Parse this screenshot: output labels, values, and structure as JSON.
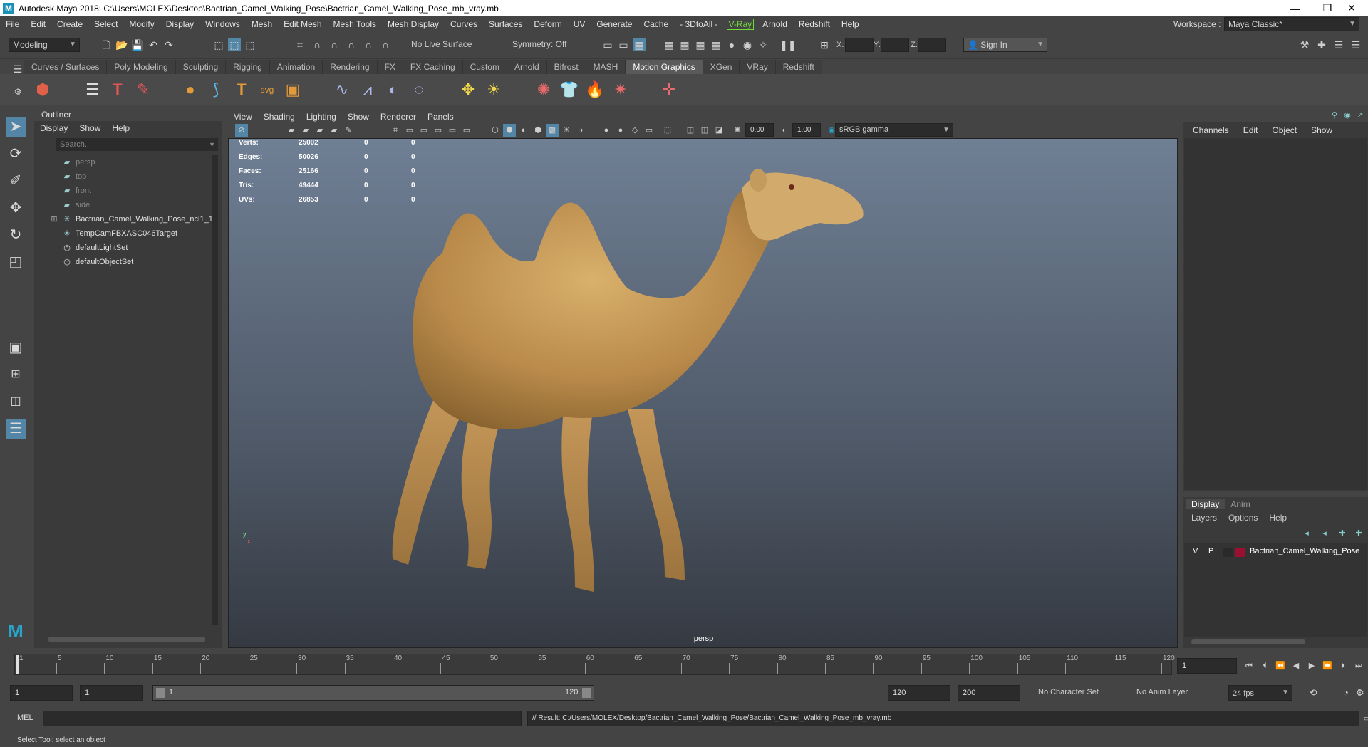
{
  "window": {
    "title": "Autodesk Maya 2018: C:\\Users\\MOLEX\\Desktop\\Bactrian_Camel_Walking_Pose\\Bactrian_Camel_Walking_Pose_mb_vray.mb",
    "logo": "M",
    "minimize": "—",
    "restore": "❐",
    "close": "✕"
  },
  "menubar": {
    "items": [
      "File",
      "Edit",
      "Create",
      "Select",
      "Modify",
      "Display",
      "Windows",
      "Mesh",
      "Edit Mesh",
      "Mesh Tools",
      "Mesh Display",
      "Curves",
      "Surfaces",
      "Deform",
      "UV",
      "Generate",
      "Cache",
      "- 3DtoAll -"
    ],
    "vray": "V-Ray",
    "items2": [
      "Arnold",
      "Redshift",
      "Help"
    ],
    "workspace_label": "Workspace :",
    "workspace_value": "Maya Classic*"
  },
  "statusline": {
    "mode": "Modeling",
    "live_surface": "No Live Surface",
    "symmetry": "Symmetry: Off",
    "x_label": "X:",
    "y_label": "Y:",
    "z_label": "Z:",
    "sign_in": "Sign In"
  },
  "shelf": {
    "tabs": [
      "Curves / Surfaces",
      "Poly Modeling",
      "Sculpting",
      "Rigging",
      "Animation",
      "Rendering",
      "FX",
      "FX Caching",
      "Custom",
      "Arnold",
      "Bifrost",
      "MASH",
      "Motion Graphics",
      "XGen",
      "VRay",
      "Redshift"
    ],
    "active_tab": "Motion Graphics"
  },
  "outliner": {
    "title": "Outliner",
    "menu": [
      "Display",
      "Show",
      "Help"
    ],
    "search_placeholder": "Search...",
    "items": [
      {
        "label": "persp",
        "dim": true
      },
      {
        "label": "top",
        "dim": true
      },
      {
        "label": "front",
        "dim": true
      },
      {
        "label": "side",
        "dim": true
      },
      {
        "label": "Bactrian_Camel_Walking_Pose_ncl1_1",
        "dim": false
      },
      {
        "label": "TempCamFBXASC046Target",
        "dim": false
      },
      {
        "label": "defaultLightSet",
        "dim": false
      },
      {
        "label": "defaultObjectSet",
        "dim": false
      }
    ]
  },
  "viewport": {
    "menu": [
      "View",
      "Shading",
      "Lighting",
      "Show",
      "Renderer",
      "Panels"
    ],
    "exposure": "0.00",
    "gamma": "1.00",
    "color_space": "sRGB gamma",
    "camera": "persp",
    "axis_y": "y",
    "axis_x": "x",
    "hud": [
      {
        "label": "Verts:",
        "v1": "25002",
        "v2": "0",
        "v3": "0"
      },
      {
        "label": "Edges:",
        "v1": "50026",
        "v2": "0",
        "v3": "0"
      },
      {
        "label": "Faces:",
        "v1": "25166",
        "v2": "0",
        "v3": "0"
      },
      {
        "label": "Tris:",
        "v1": "49444",
        "v2": "0",
        "v3": "0"
      },
      {
        "label": "UVs:",
        "v1": "26853",
        "v2": "0",
        "v3": "0"
      }
    ]
  },
  "channelbox": {
    "menu": [
      "Channels",
      "Edit",
      "Object",
      "Show"
    ]
  },
  "layers": {
    "tabs": [
      "Display",
      "Anim"
    ],
    "menu": [
      "Layers",
      "Options",
      "Help"
    ],
    "layer": {
      "v": "V",
      "p": "P",
      "name": "Bactrian_Camel_Walking_Pose",
      "color": "#9b1030"
    }
  },
  "timeline": {
    "ticks": [
      "1",
      "5",
      "10",
      "15",
      "20",
      "25",
      "30",
      "35",
      "40",
      "45",
      "50",
      "55",
      "60",
      "65",
      "70",
      "75",
      "80",
      "85",
      "90",
      "95",
      "100",
      "105",
      "110",
      "115",
      "120"
    ],
    "current_frame": "1"
  },
  "range": {
    "start": "1",
    "playback_start": "1",
    "slider_start": "1",
    "slider_end": "120",
    "playback_end": "120",
    "end": "200",
    "character_set": "No Character Set",
    "anim_layer": "No Anim Layer",
    "fps": "24 fps"
  },
  "commandline": {
    "lang": "MEL",
    "result": "// Result: C:/Users/MOLEX/Desktop/Bactrian_Camel_Walking_Pose/Bactrian_Camel_Walking_Pose_mb_vray.mb"
  },
  "helpline": "Select Tool: select an object"
}
